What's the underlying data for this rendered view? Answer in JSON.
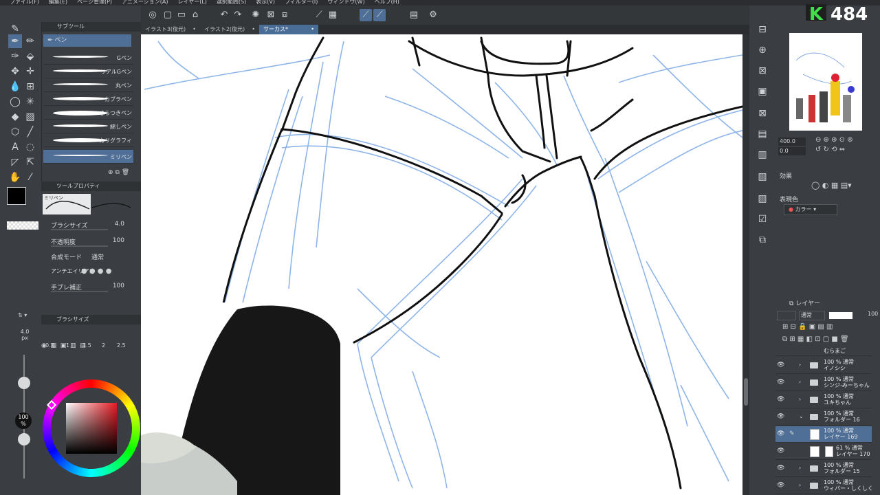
{
  "menu": [
    "ファイル(F)",
    "編集(E)",
    "ページ管理(P)",
    "アニメーション(A)",
    "レイヤー(L)",
    "選択範囲(S)",
    "表示(V)",
    "フィルター(I)",
    "ウィンドウ(W)",
    "ヘルプ(H)"
  ],
  "stream_logo": {
    "letter": "K",
    "count": "484"
  },
  "tabs": [
    "イラスト3(復元)",
    "イラスト2(復元)",
    "サーカス*"
  ],
  "subtool": {
    "header": "サブツール",
    "selected_group": "ペン",
    "brushes": [
      "Gペン",
      "リアルGペン",
      "丸ペン",
      "カブラペン",
      "さらつきペン",
      "綿しペン",
      "カリグラフィ",
      "ミリペン"
    ]
  },
  "tool_property": {
    "header": "ツールプロパティ",
    "preview_label": "ミリペン",
    "rows": [
      {
        "key": "ブラシサイズ",
        "value": "4.0"
      },
      {
        "key": "不透明度",
        "value": "100"
      },
      {
        "key": "合成モード",
        "value": "通常"
      },
      {
        "key": "アンチエイリアス",
        "value": ""
      },
      {
        "key": "手ブレ補正",
        "value": "100"
      }
    ]
  },
  "brush_size_panel": {
    "header": "ブラシサイズ",
    "current": "4.0",
    "unit": "px",
    "sizes": [
      "0.7",
      "1",
      "1.5",
      "2",
      "2.5"
    ]
  },
  "color": {
    "main": "#000000",
    "opacity_label": "100",
    "opacity_unit": "%"
  },
  "navigator": {
    "zoom": "400.0",
    "angle": "0.0"
  },
  "effect": {
    "header": "効果",
    "expression_label": "表現色",
    "expression_value": "カラー"
  },
  "layers": {
    "header": "レイヤー",
    "blend": "通常",
    "opacity": "100",
    "items": [
      {
        "line1": "むらまご",
        "line2": "",
        "type": "folder"
      },
      {
        "line1": "100 % 通常",
        "line2": "イノシシ",
        "type": "folder"
      },
      {
        "line1": "100 % 通常",
        "line2": "シンジ-みーちゃん",
        "type": "folder"
      },
      {
        "line1": "100 % 通常",
        "line2": "ユキちゃん",
        "type": "folder"
      },
      {
        "line1": "100 % 通常",
        "line2": "フォルダー 16",
        "type": "folder"
      },
      {
        "line1": "100 % 通常",
        "line2": "レイヤー 169",
        "type": "layer",
        "selected": true
      },
      {
        "line1": "61 % 通常",
        "line2": "レイヤー 170",
        "type": "layer"
      },
      {
        "line1": "100 % 通常",
        "line2": "フォルダー 15",
        "type": "folder"
      },
      {
        "line1": "100 % 通常",
        "line2": "ウィバー・しくしく",
        "type": "folder"
      }
    ]
  }
}
